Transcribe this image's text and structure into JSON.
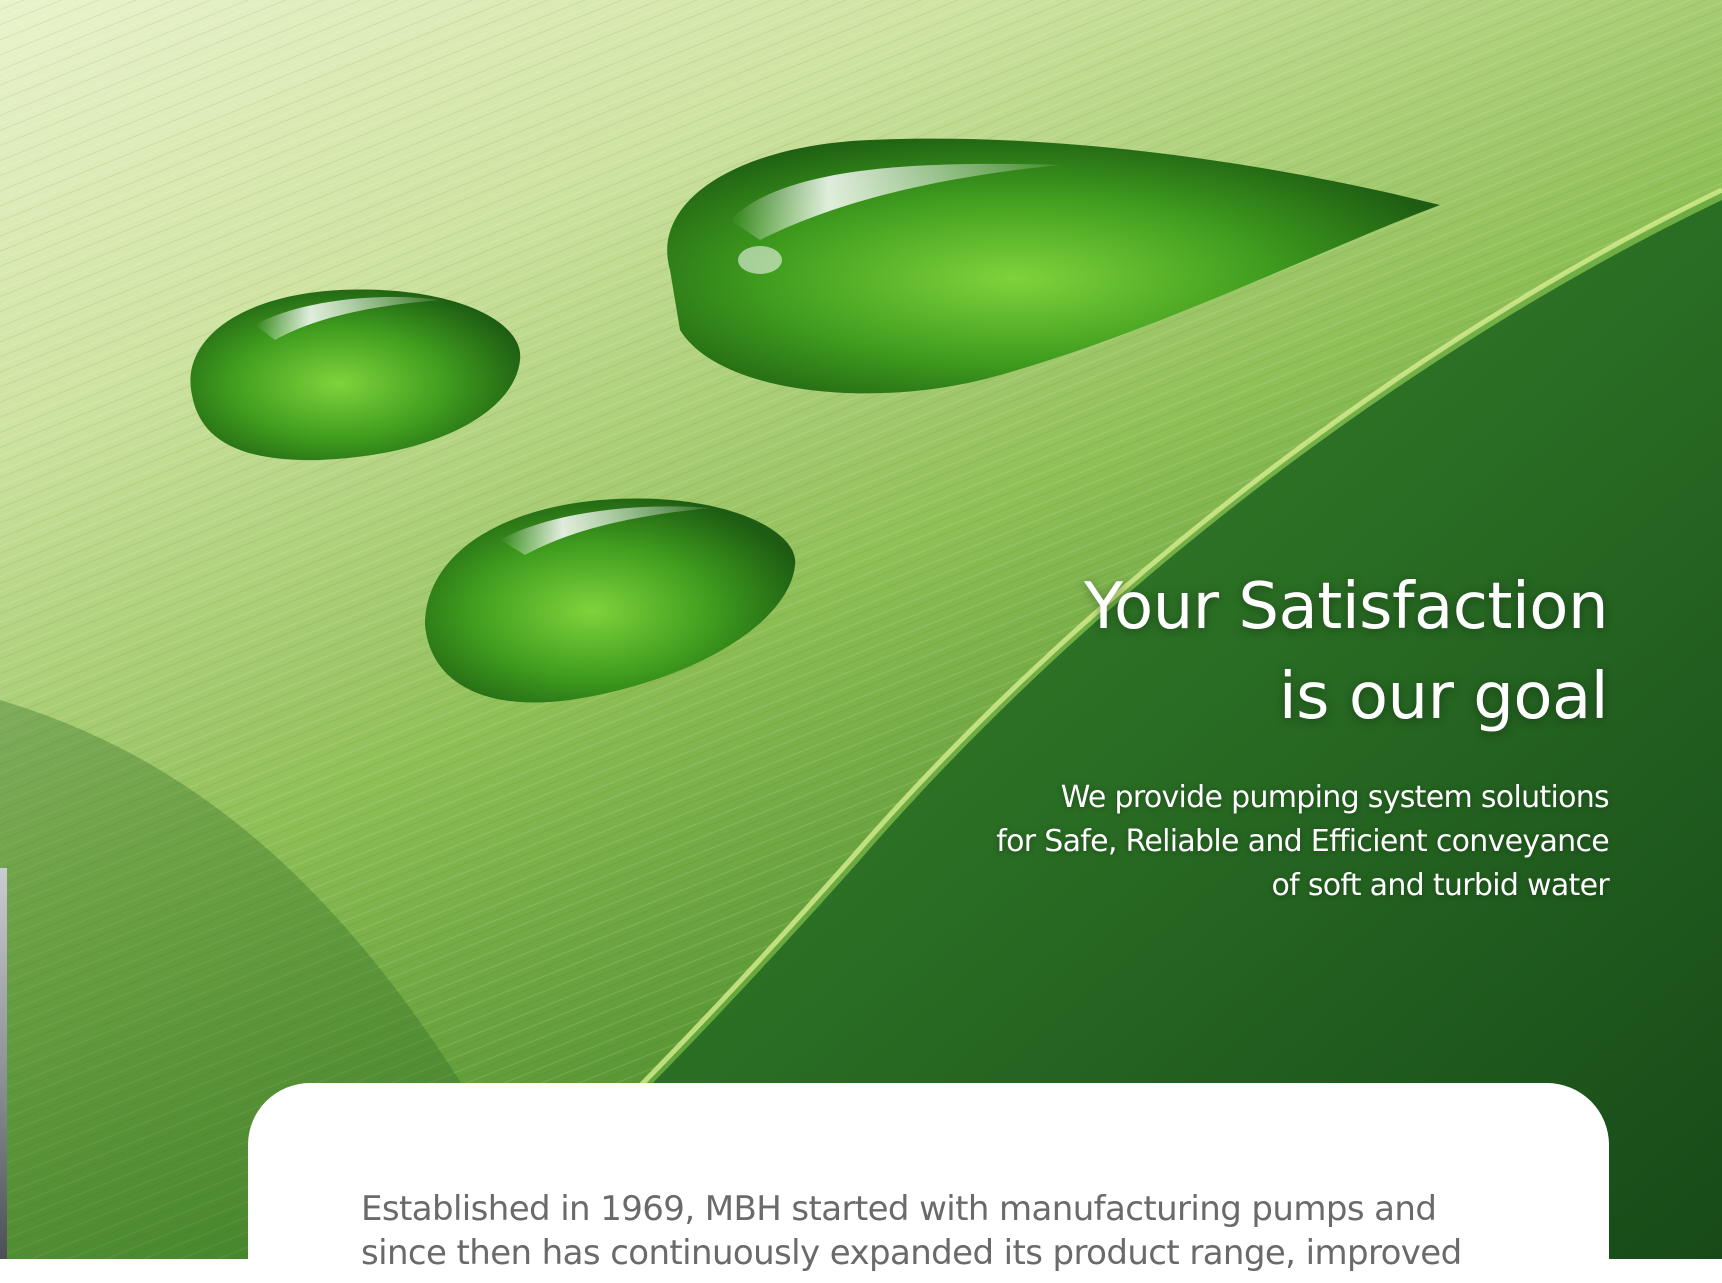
{
  "hero": {
    "headline_line1": "Your Satisfaction",
    "headline_line2": "is our goal",
    "subline_line1": "We provide pumping system solutions",
    "subline_line2": "for Safe, Reliable and Efficient conveyance",
    "subline_line3": "of soft and turbid water"
  },
  "card": {
    "paragraph_line1": "Established in 1969, MBH started with manufacturing pumps and",
    "paragraph_line2": "since then has continuously expanded its product range, improved"
  },
  "colors": {
    "leaf_light": "#cfe3a6",
    "leaf_dark": "#1f5a22",
    "droplet": "#3f9a1f",
    "text_white": "#ffffff",
    "card_text": "#6a6a6a"
  }
}
